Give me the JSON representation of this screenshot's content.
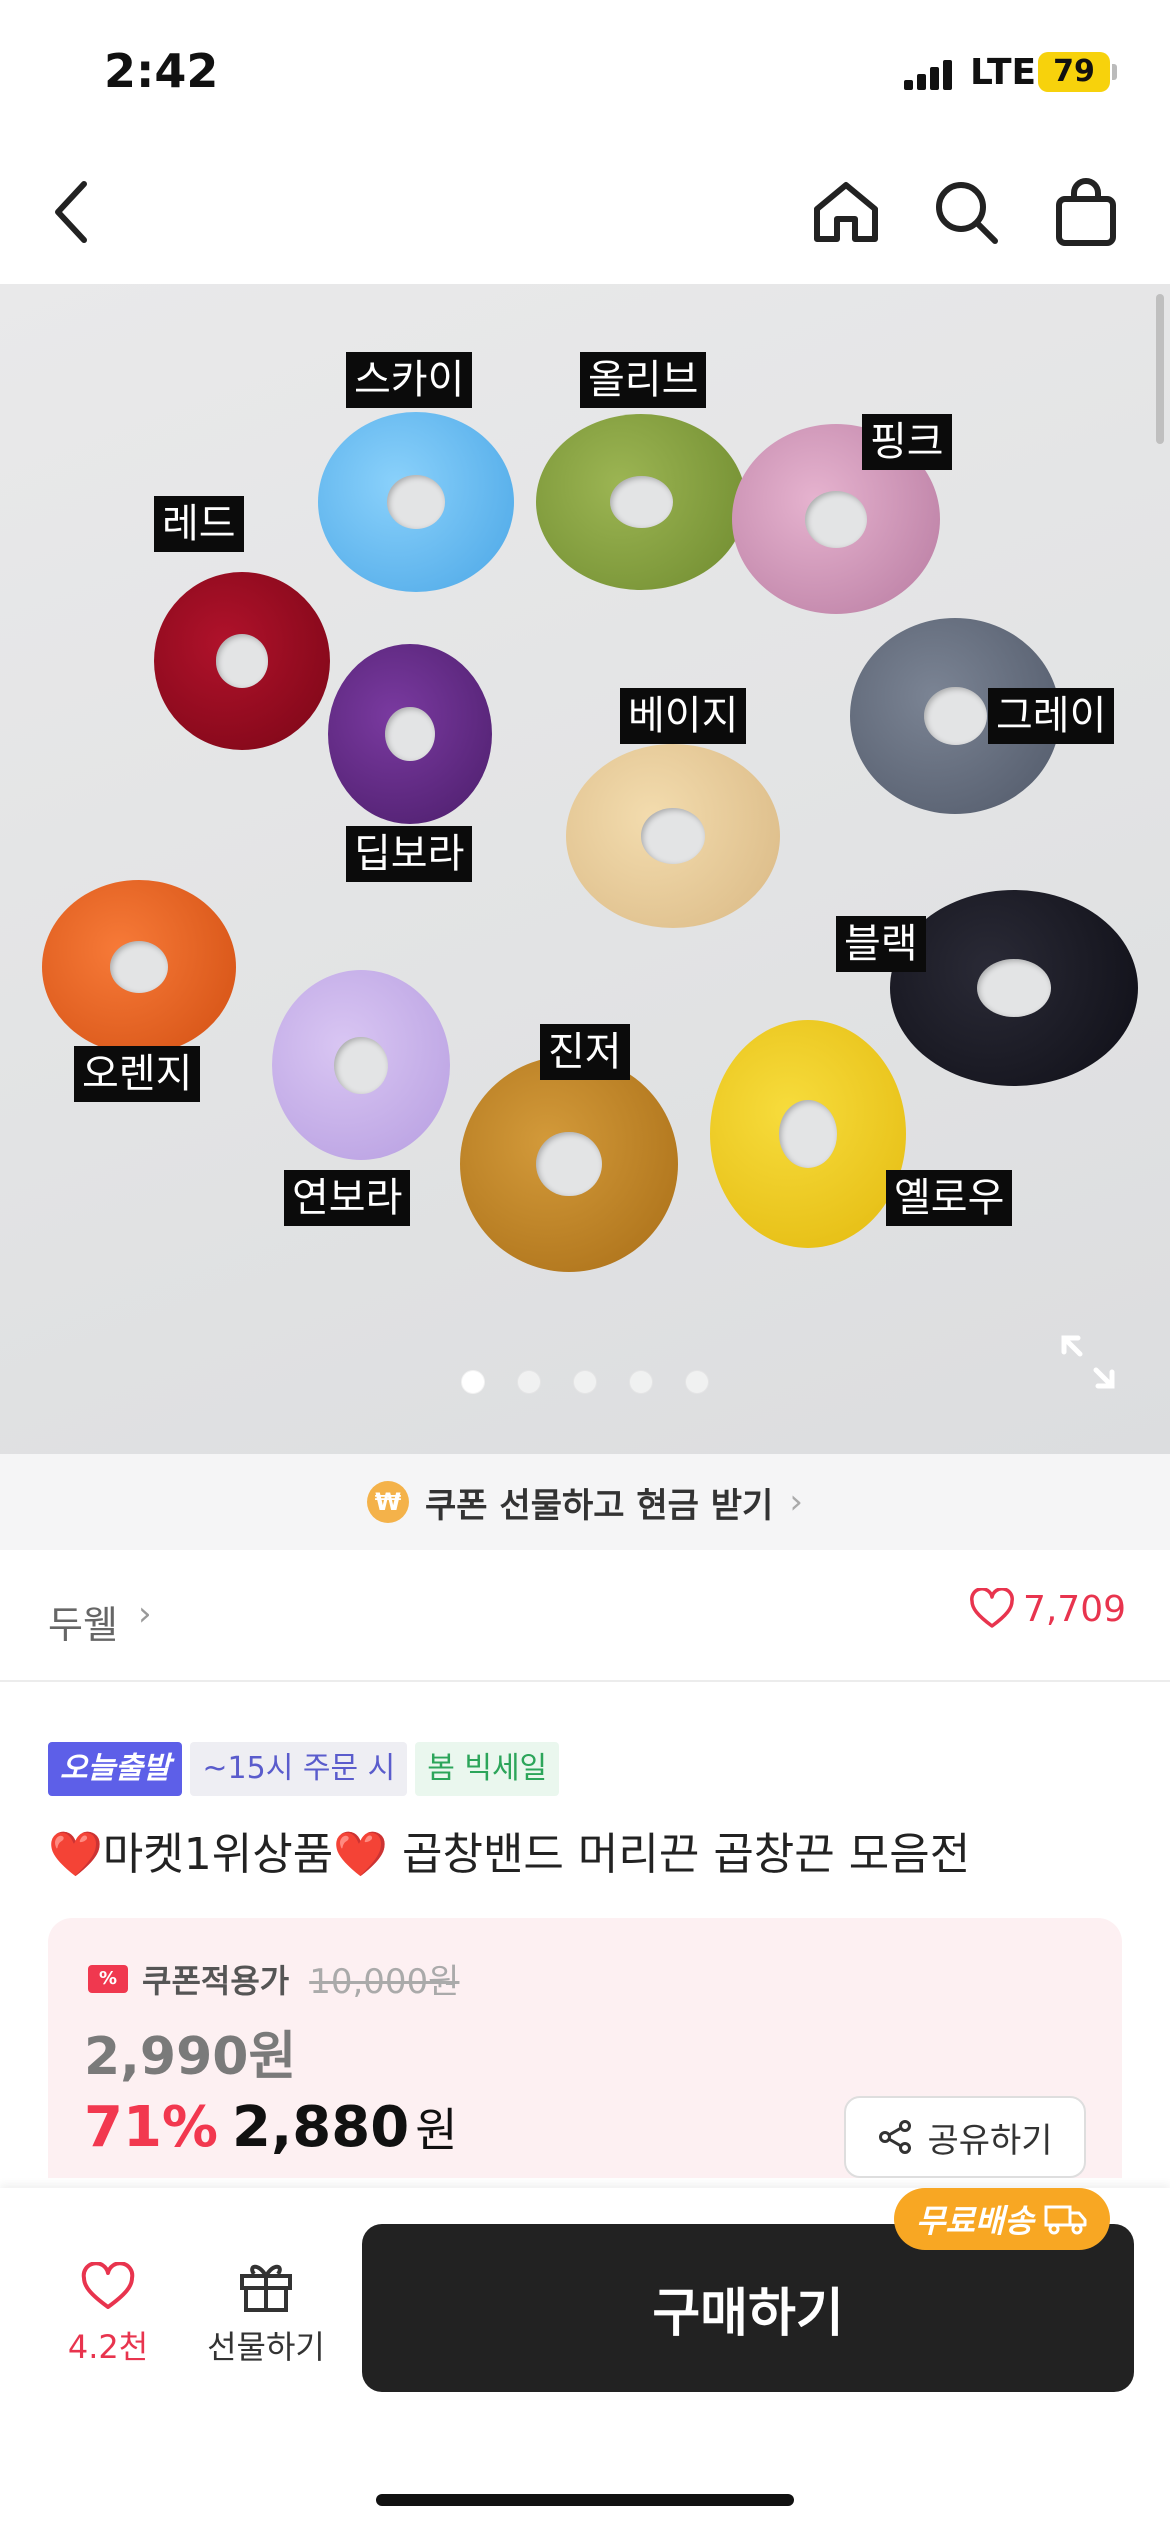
{
  "status_bar": {
    "time": "2:42",
    "network": "LTE",
    "battery": "79"
  },
  "nav": {
    "icons": [
      "back-icon",
      "home-icon",
      "search-icon",
      "cart-icon"
    ]
  },
  "hero": {
    "labels": {
      "sky": "스카이",
      "olive": "올리브",
      "pink": "핑크",
      "red": "레드",
      "grey": "그레이",
      "deep_purple": "딥보라",
      "beige": "베이지",
      "black": "블랙",
      "orange": "오렌지",
      "mustard": "진저",
      "lavender": "연보라",
      "yellow": "옐로우"
    },
    "dots_total": 5,
    "dots_active": 1
  },
  "coupon_strip": {
    "coin": "₩",
    "text": "쿠폰 선물하고 현금 받기"
  },
  "seller": {
    "name": "두웰",
    "likes": "7,709"
  },
  "badges": {
    "today": "오늘출발",
    "time": "~15시 주문 시",
    "sale": "봄 빅세일"
  },
  "product": {
    "heart1": "❤️",
    "title_part1": "마켓1위상품",
    "heart2": "❤️",
    "title_part2": " 곱창밴드 머리끈 곱창끈 모음전"
  },
  "price": {
    "coupon_label": "쿠폰적용가",
    "original": "10,000원",
    "coupon_price": "2,990원",
    "discount": "71%",
    "sale_price": "2,880",
    "won": "원",
    "share_label": "공유하기"
  },
  "bottom": {
    "wish_count": "4.2천",
    "gift_label": "선물하기",
    "buy_label": "구매하기",
    "free_ship": "무료배송"
  },
  "colors": {
    "accent": "#f2384f",
    "badge_today": "#5d5fe8",
    "buy_button": "#222222",
    "free_ship": "#f8a723"
  }
}
